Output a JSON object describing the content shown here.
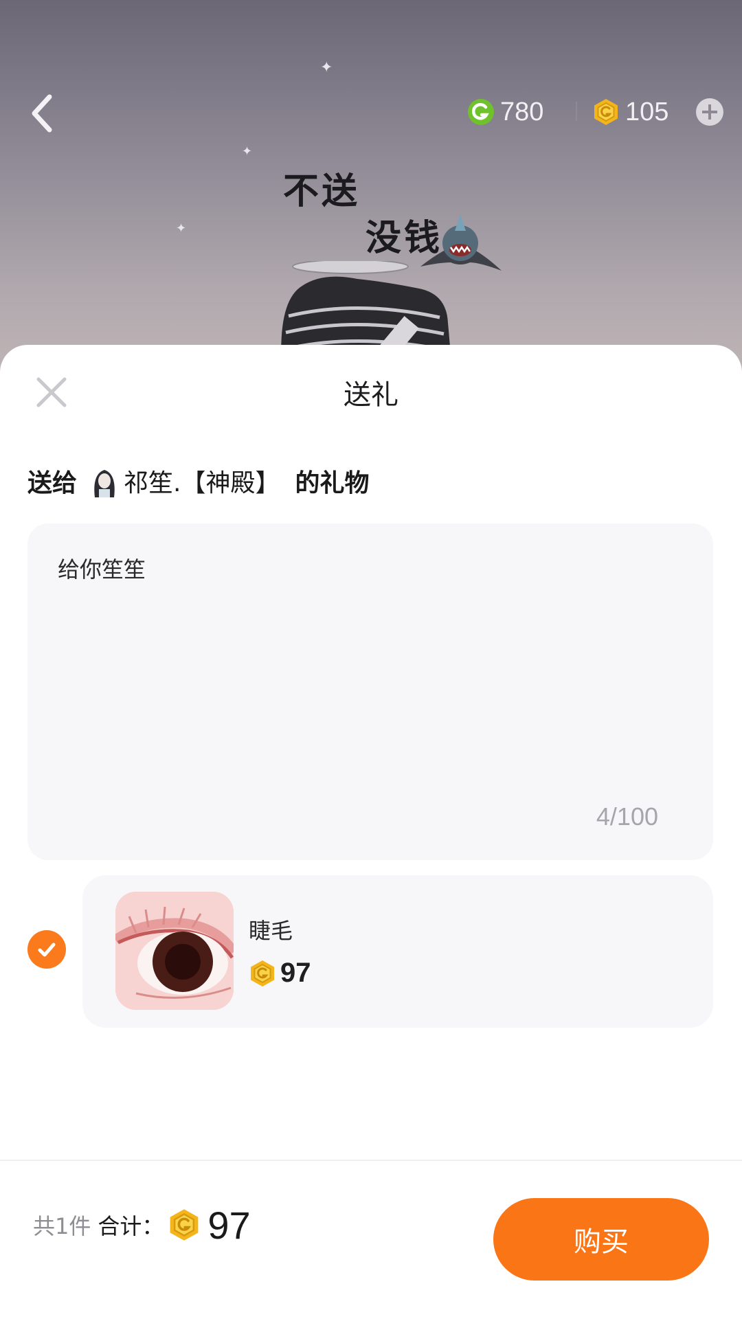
{
  "header": {
    "green_coins": "780",
    "gold_coins": "105"
  },
  "scene_text": {
    "line1": "不送",
    "line2": "没钱"
  },
  "sheet": {
    "title": "送礼",
    "recipient_prefix": "送给",
    "recipient_name": "祁笙.【神殿】",
    "recipient_suffix": "的礼物",
    "message": "给你笙笙",
    "message_counter": "4/100"
  },
  "gift": {
    "name": "睫毛",
    "price": "97",
    "selected": true
  },
  "footer": {
    "count_text": "共1件",
    "total_label": "合计：",
    "total_value": "97",
    "buy_label": "购买"
  },
  "colors": {
    "accent": "#fa7516",
    "green_coin": "#6fc22c",
    "gold_coin": "#f3b51b"
  }
}
